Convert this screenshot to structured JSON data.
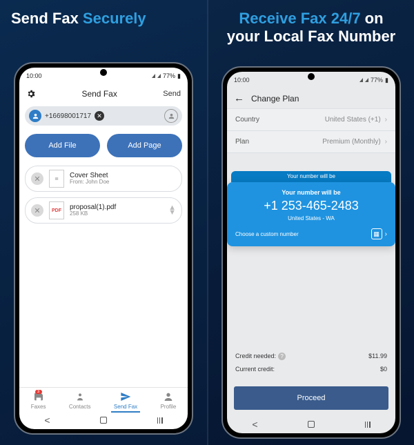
{
  "left": {
    "hero_plain": "Send Fax ",
    "hero_accent": "Securely",
    "status": {
      "time": "10:00",
      "battery": "77%"
    },
    "header": {
      "title": "Send Fax",
      "action": "Send"
    },
    "recipient": {
      "number": "+16698001717"
    },
    "buttons": {
      "add_file": "Add File",
      "add_page": "Add Page"
    },
    "files": [
      {
        "title": "Cover Sheet",
        "sub": "From: John Doe",
        "kind": "doc"
      },
      {
        "title": "proposal(1).pdf",
        "sub": "258 KB",
        "kind": "pdf"
      }
    ],
    "tabs": {
      "faxes": "Faxes",
      "faxes_badge": "3",
      "contacts": "Contacts",
      "sendfax": "Send Fax",
      "profile": "Profile"
    }
  },
  "right": {
    "hero_accent": "Receive Fax 24/7",
    "hero_plain_1": " on",
    "hero_plain_2": "your Local Fax Number",
    "status": {
      "time": "10:00",
      "battery": "77%"
    },
    "header": {
      "title": "Change Plan"
    },
    "rows": {
      "country_label": "Country",
      "country_value": "United States (+1)",
      "plan_label": "Plan",
      "plan_value": "Premium (Monthly)"
    },
    "peek_label": "Your number will be",
    "card": {
      "label": "Your number will be",
      "number": "+1 253-465-2483",
      "location": "United States - WA",
      "custom": "Choose a custom number"
    },
    "credit": {
      "needed_label": "Credit needed:",
      "needed_value": "$11.99",
      "current_label": "Current credit:",
      "current_value": "$0"
    },
    "proceed": "Proceed"
  }
}
